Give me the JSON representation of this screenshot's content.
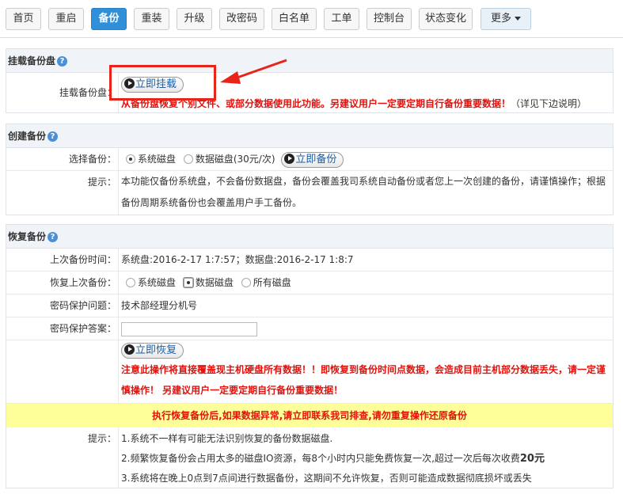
{
  "nav": {
    "items": [
      "首页",
      "重启",
      "备份",
      "重装",
      "升级",
      "改密码",
      "白名单",
      "工单",
      "控制台",
      "状态变化"
    ],
    "more_label": "更多",
    "active": "备份"
  },
  "mount": {
    "title": "挂载备份盘",
    "label": "挂载备份盘：",
    "button": "立即挂载",
    "note_red": "从备份盘恢复个别文件、或部分数据使用此功能。另建议用户一定要定期自行备份重要数据！",
    "note_normal": "（详见下边说明）"
  },
  "create": {
    "title": "创建备份",
    "select_label": "选择备份：",
    "option_system": "系统磁盘",
    "option_data": "数据磁盘(30元/次)",
    "button": "立即备份",
    "tip_label": "提示：",
    "tip_text": "本功能仅备份系统盘，不会备份数据盘，备份会覆盖我司系统自动备份或者您上一次创建的备份，请谨慎操作；根据备份周期系统备份也会覆盖用户手工备份。"
  },
  "restore": {
    "title": "恢复备份",
    "last_label": "上次备份时间：",
    "last_value": "系统盘:2016-2-17 1:7:57；数据盘:2016-2-17 1:8:7",
    "restore_label": "恢复上次备份：",
    "opt_system": "系统磁盘",
    "opt_data": "数据磁盘",
    "opt_all": "所有磁盘",
    "question_label": "密码保护问题：",
    "question_value": "技术部经理分机号",
    "answer_label": "密码保护答案：",
    "answer_value": "",
    "button": "立即恢复",
    "warn_red": "注意此操作将直接覆盖现主机硬盘所有数据！！即恢复到备份时间点数据，会造成目前主机部分数据丢失，请一定谨慎操作！ 另建议用户一定要定期自行备份重要数据！",
    "yellow_bar": "执行恢复备份后,如果数据异常,请立即联系我司排查,请勿重复操作还原备份",
    "tips_label": "提示：",
    "tip1": "1.系统不一样有可能无法识别恢复的备份数据磁盘.",
    "tip2_pre": "2.频繁恢复备份会占用太多的磁盘IO资源，每8个小时内只能免费恢复一次,超过一次后每次收费",
    "tip2_price": "20元",
    "tip3": "3.系统将在晚上0点到7点间进行数据备份，这期间不允许恢复，否则可能造成数据彻底损坏或丢失"
  },
  "colors": {
    "accent": "#2f8fd8",
    "warning": "#e8100a",
    "highlight": "#ffff99",
    "annotation": "#e8231a"
  }
}
